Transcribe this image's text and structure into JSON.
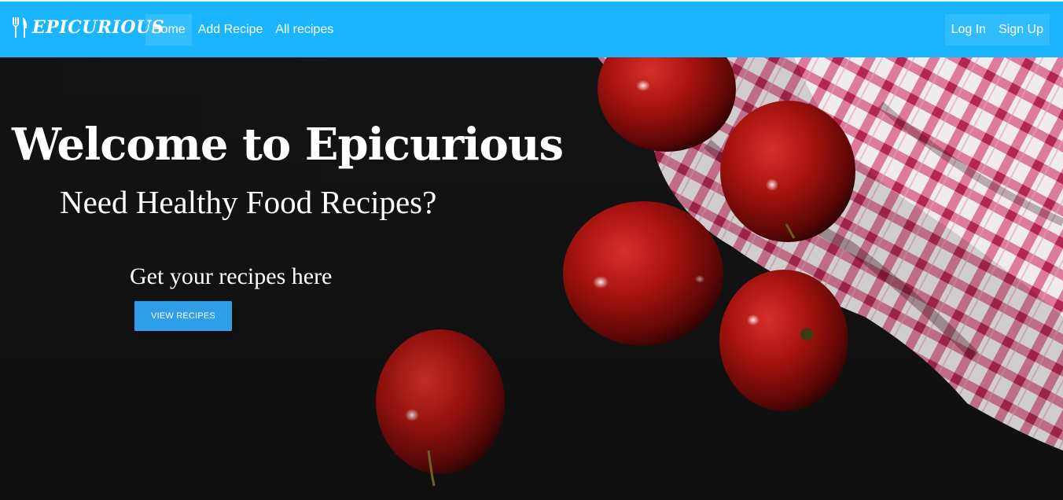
{
  "navbar": {
    "brand_icon": "fork-knife-icon",
    "brand": "EPICURIOUS",
    "left_links": [
      {
        "label": "Home",
        "active": true
      },
      {
        "label": "Add Recipe",
        "active": false
      },
      {
        "label": "All recipes",
        "active": false
      }
    ],
    "right_links": [
      {
        "label": "Log In"
      },
      {
        "label": "Sign Up"
      }
    ],
    "color": "#1ab5fe"
  },
  "hero": {
    "title": "Welcome to Epicurious",
    "subtitle": "Need Healthy Food Recipes?",
    "cta_text": "Get your recipes here",
    "button_label": "VIEW RECIPES",
    "button_color": "#2f9ee8"
  }
}
